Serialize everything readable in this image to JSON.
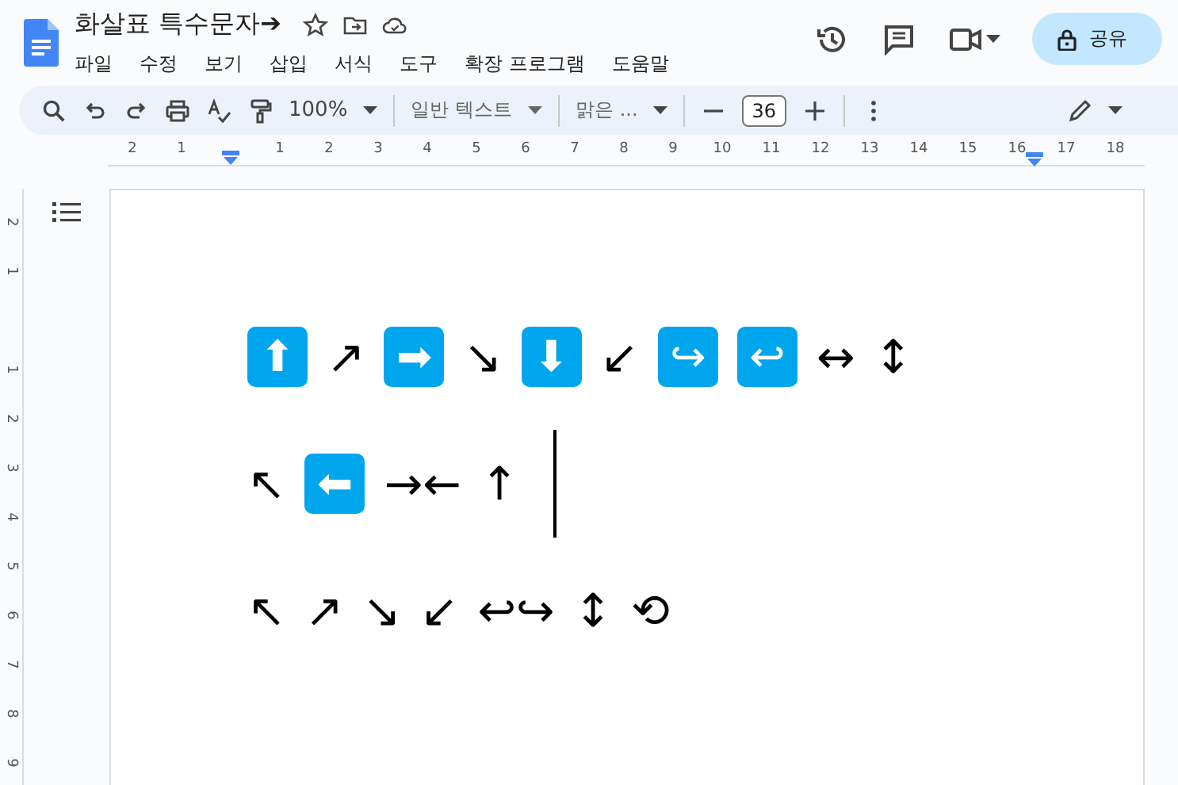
{
  "document": {
    "title": "화살표 특수문자➔"
  },
  "menu": [
    {
      "label": "파일"
    },
    {
      "label": "수정"
    },
    {
      "label": "보기"
    },
    {
      "label": "삽입"
    },
    {
      "label": "서식"
    },
    {
      "label": "도구"
    },
    {
      "label": "확장 프로그램"
    },
    {
      "label": "도움말"
    }
  ],
  "share_button": {
    "label": "공유"
  },
  "toolbar": {
    "zoom": "100%",
    "style": "일반 텍스트",
    "font": "맑은 ...",
    "font_size": "36"
  },
  "ruler": [
    {
      "kind": "number",
      "label": "2"
    },
    {
      "kind": "number",
      "label": "1"
    },
    {
      "kind": "marker"
    },
    {
      "kind": "number",
      "label": "1"
    },
    {
      "kind": "number",
      "label": "2"
    },
    {
      "kind": "number",
      "label": "3"
    },
    {
      "kind": "number",
      "label": "4"
    },
    {
      "kind": "number",
      "label": "5"
    },
    {
      "kind": "number",
      "label": "6"
    },
    {
      "kind": "number",
      "label": "7"
    },
    {
      "kind": "number",
      "label": "8"
    },
    {
      "kind": "number",
      "label": "9"
    },
    {
      "kind": "number",
      "label": "10"
    },
    {
      "kind": "number",
      "label": "11"
    },
    {
      "kind": "number",
      "label": "12"
    },
    {
      "kind": "number",
      "label": "13"
    },
    {
      "kind": "number",
      "label": "14"
    },
    {
      "kind": "number",
      "label": "15"
    },
    {
      "kind": "marked-number",
      "label": "16"
    },
    {
      "kind": "number",
      "label": "17"
    },
    {
      "kind": "number",
      "label": "18"
    }
  ],
  "vertical_ruler": [
    {
      "kind": "number",
      "label": "2"
    },
    {
      "kind": "number",
      "label": "1"
    },
    {
      "kind": "gap"
    },
    {
      "kind": "number",
      "label": "1"
    },
    {
      "kind": "number",
      "label": "2"
    },
    {
      "kind": "number",
      "label": "3"
    },
    {
      "kind": "number",
      "label": "4"
    },
    {
      "kind": "number",
      "label": "5"
    },
    {
      "kind": "number",
      "label": "6"
    },
    {
      "kind": "number",
      "label": "7"
    },
    {
      "kind": "number",
      "label": "8"
    },
    {
      "kind": "number",
      "label": "9"
    }
  ],
  "lines": [
    {
      "cursor": false,
      "glyphs": [
        {
          "char": "⬆",
          "kind": "emoji"
        },
        {
          "char": "↗",
          "kind": "plain"
        },
        {
          "char": "➡",
          "kind": "emoji"
        },
        {
          "char": "↘",
          "kind": "plain"
        },
        {
          "char": "⬇",
          "kind": "emoji"
        },
        {
          "char": "↙",
          "kind": "plain"
        },
        {
          "char": "↪",
          "kind": "emoji"
        },
        {
          "char": "↩",
          "kind": "emoji"
        },
        {
          "char": "↔",
          "kind": "plain"
        },
        {
          "char": "↕",
          "kind": "plain"
        }
      ]
    },
    {
      "cursor": true,
      "glyphs": [
        {
          "char": "↖",
          "kind": "plain"
        },
        {
          "char": "⬅",
          "kind": "emoji"
        },
        {
          "char": "→←",
          "kind": "plain"
        },
        {
          "char": "↑",
          "kind": "plain"
        }
      ]
    },
    {
      "cursor": false,
      "glyphs": [
        {
          "char": "↖",
          "kind": "plain"
        },
        {
          "char": "↗",
          "kind": "plain"
        },
        {
          "char": "↘",
          "kind": "plain"
        },
        {
          "char": "↙",
          "kind": "plain"
        },
        {
          "char": "↩↪",
          "kind": "plain"
        },
        {
          "char": "↕",
          "kind": "plain"
        },
        {
          "char": "⟲",
          "kind": "plain"
        }
      ]
    }
  ]
}
